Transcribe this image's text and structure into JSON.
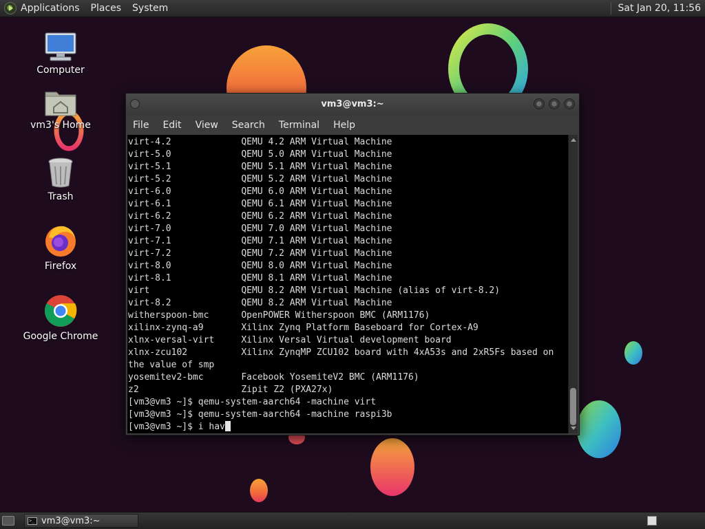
{
  "top_panel": {
    "menus": [
      "Applications",
      "Places",
      "System"
    ],
    "clock": "Sat Jan 20, 11:56"
  },
  "desktop_icons": [
    {
      "label": "Computer",
      "icon": "computer-icon"
    },
    {
      "label": "vm3's Home",
      "icon": "home-folder-icon"
    },
    {
      "label": "Trash",
      "icon": "trash-icon"
    },
    {
      "label": "Firefox",
      "icon": "firefox-icon"
    },
    {
      "label": "Google Chrome",
      "icon": "chrome-icon"
    }
  ],
  "window": {
    "title": "vm3@vm3:~",
    "menus": [
      "File",
      "Edit",
      "View",
      "Search",
      "Terminal",
      "Help"
    ]
  },
  "terminal": {
    "lines": [
      "virt-4.2             QEMU 4.2 ARM Virtual Machine",
      "virt-5.0             QEMU 5.0 ARM Virtual Machine",
      "virt-5.1             QEMU 5.1 ARM Virtual Machine",
      "virt-5.2             QEMU 5.2 ARM Virtual Machine",
      "virt-6.0             QEMU 6.0 ARM Virtual Machine",
      "virt-6.1             QEMU 6.1 ARM Virtual Machine",
      "virt-6.2             QEMU 6.2 ARM Virtual Machine",
      "virt-7.0             QEMU 7.0 ARM Virtual Machine",
      "virt-7.1             QEMU 7.1 ARM Virtual Machine",
      "virt-7.2             QEMU 7.2 ARM Virtual Machine",
      "virt-8.0             QEMU 8.0 ARM Virtual Machine",
      "virt-8.1             QEMU 8.1 ARM Virtual Machine",
      "virt                 QEMU 8.2 ARM Virtual Machine (alias of virt-8.2)",
      "virt-8.2             QEMU 8.2 ARM Virtual Machine",
      "witherspoon-bmc      OpenPOWER Witherspoon BMC (ARM1176)",
      "xilinx-zynq-a9       Xilinx Zynq Platform Baseboard for Cortex-A9",
      "xlnx-versal-virt     Xilinx Versal Virtual development board",
      "xlnx-zcu102          Xilinx ZynqMP ZCU102 board with 4xA53s and 2xR5Fs based on",
      "the value of smp",
      "yosemitev2-bmc       Facebook YosemiteV2 BMC (ARM1176)",
      "z2                   Zipit Z2 (PXA27x)",
      "[vm3@vm3 ~]$ qemu-system-aarch64 -machine virt",
      "[vm3@vm3 ~]$ qemu-system-aarch64 -machine raspi3b"
    ],
    "prompt": "[vm3@vm3 ~]$ ",
    "input": "i hav"
  },
  "taskbar": {
    "task_label": "vm3@vm3:~"
  },
  "colors": {
    "wallpaper": "#1e0c1e",
    "terminal_bg": "#000000",
    "terminal_fg": "#dcdcdc"
  }
}
